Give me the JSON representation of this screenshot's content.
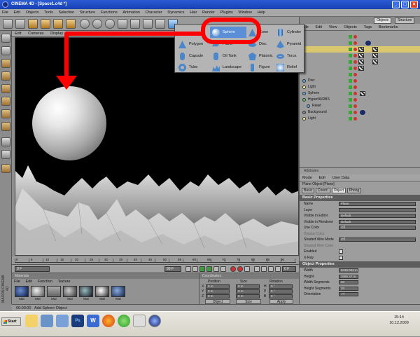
{
  "window": {
    "title": "CINEMA 4D - [Space1.c4d *]",
    "minimize": "_",
    "maximize": "□",
    "close": "×"
  },
  "menubar": [
    "File",
    "Edit",
    "Objects",
    "Tools",
    "Selection",
    "Structure",
    "Functions",
    "Animation",
    "Character",
    "Dynamics",
    "Hair",
    "Render",
    "Plugins",
    "Window",
    "Help"
  ],
  "viewport_menu": [
    "Edit",
    "Cameras",
    "Display",
    "Filter",
    "View"
  ],
  "object_manager": {
    "tabs": [
      "Objects",
      "Structure"
    ],
    "menu": [
      "File",
      "Edit",
      "View",
      "Objects",
      "Tags",
      "Bookmarks"
    ],
    "objects": [
      "Disc",
      "Light",
      "Sphere",
      "HyperNURBS",
      "Relief",
      "Background",
      "Light"
    ]
  },
  "primitive_menu": {
    "items": [
      {
        "label": "Sphere",
        "icon": "sphere-icon"
      },
      {
        "label": "Cone",
        "icon": "cone-icon"
      },
      {
        "label": "Cylinder",
        "icon": "cylinder-icon"
      },
      {
        "label": "Polygon",
        "icon": "polygon-icon"
      },
      {
        "label": "Plane",
        "icon": "plane-icon"
      },
      {
        "label": "Disc",
        "icon": "disc-icon"
      },
      {
        "label": "Pyramid",
        "icon": "pyramid-icon"
      },
      {
        "label": "Capsule",
        "icon": "capsule-icon"
      },
      {
        "label": "Oil Tank",
        "icon": "oiltank-icon"
      },
      {
        "label": "Platonic",
        "icon": "platonic-icon"
      },
      {
        "label": "Torus",
        "icon": "torus-icon"
      },
      {
        "label": "Tube",
        "icon": "tube-icon"
      },
      {
        "label": "Landscape",
        "icon": "landscape-icon"
      },
      {
        "label": "Figure",
        "icon": "figure-icon"
      },
      {
        "label": "Relief",
        "icon": "relief-icon"
      }
    ],
    "selected": "Sphere"
  },
  "attributes": {
    "header": "Attributes",
    "menu": [
      "Mode",
      "Edit",
      "User Data"
    ],
    "object_title": "Plane Object [Plane]",
    "tabs": [
      "Basic",
      "Coord.",
      "Object",
      "Phong"
    ],
    "active_tab": "Object",
    "basic_section": "Basic Properties",
    "basic_props": [
      {
        "label": "Name",
        "value": "Plane"
      },
      {
        "label": "Layer",
        "value": ""
      },
      {
        "label": "Visible in Editor",
        "value": "Default"
      },
      {
        "label": "Visible in Renderer",
        "value": "Default"
      },
      {
        "label": "Use Color",
        "value": "Off"
      },
      {
        "label": "Display Color",
        "value": ""
      },
      {
        "label": "Shaded Wire Mode",
        "value": "Off"
      },
      {
        "label": "Shaded Wire Color",
        "value": ""
      },
      {
        "label": "Enabled",
        "value": ""
      },
      {
        "label": "X-Ray",
        "value": ""
      }
    ],
    "object_section": "Object Properties",
    "object_props": [
      {
        "label": "Width",
        "value": "8416.053 m"
      },
      {
        "label": "Height",
        "value": "3085.37 m"
      },
      {
        "label": "Width Segments",
        "value": "20"
      },
      {
        "label": "Height Segments",
        "value": "20"
      },
      {
        "label": "Orientation",
        "value": "+Y"
      }
    ]
  },
  "timeline": {
    "ticks": [
      "0",
      "5",
      "10",
      "15",
      "20",
      "25",
      "30",
      "35",
      "40",
      "45",
      "50",
      "55",
      "60",
      "65",
      "70",
      "75",
      "80",
      "85",
      "90"
    ],
    "start_field": "0 F",
    "end_field": "90 F",
    "current_frame": "0 F"
  },
  "materials": {
    "header": "Materials",
    "menu": [
      "File",
      "Edit",
      "Function",
      "Texture"
    ],
    "items": [
      "Mat",
      "Mat",
      "Mat",
      "Mat",
      "Mat",
      "Mat",
      "Mat"
    ]
  },
  "coordinates": {
    "header": "Coordinates",
    "columns": [
      "Position",
      "Size",
      "Rotation"
    ],
    "axes": [
      "X",
      "Y",
      "Z"
    ],
    "rot_axes": [
      "H",
      "P",
      "B"
    ],
    "pos": [
      "0 m",
      "0 m",
      "0 m"
    ],
    "size": [
      "0 m",
      "0 m",
      "0 m"
    ],
    "rot": [
      "0 °",
      "0 °",
      "0 °"
    ],
    "dropdown1": "Object",
    "dropdown2": "Size",
    "apply": "Apply"
  },
  "status": {
    "time": "00:00:00",
    "message": "Add Sphere Object"
  },
  "taskbar": {
    "start": "Start",
    "clock_time": "15:14",
    "clock_date": "10.12.2009"
  },
  "colors": {
    "annotation": "#ff0000",
    "title_blue": "#2a5bd4",
    "viewport_bg": "#000000"
  }
}
